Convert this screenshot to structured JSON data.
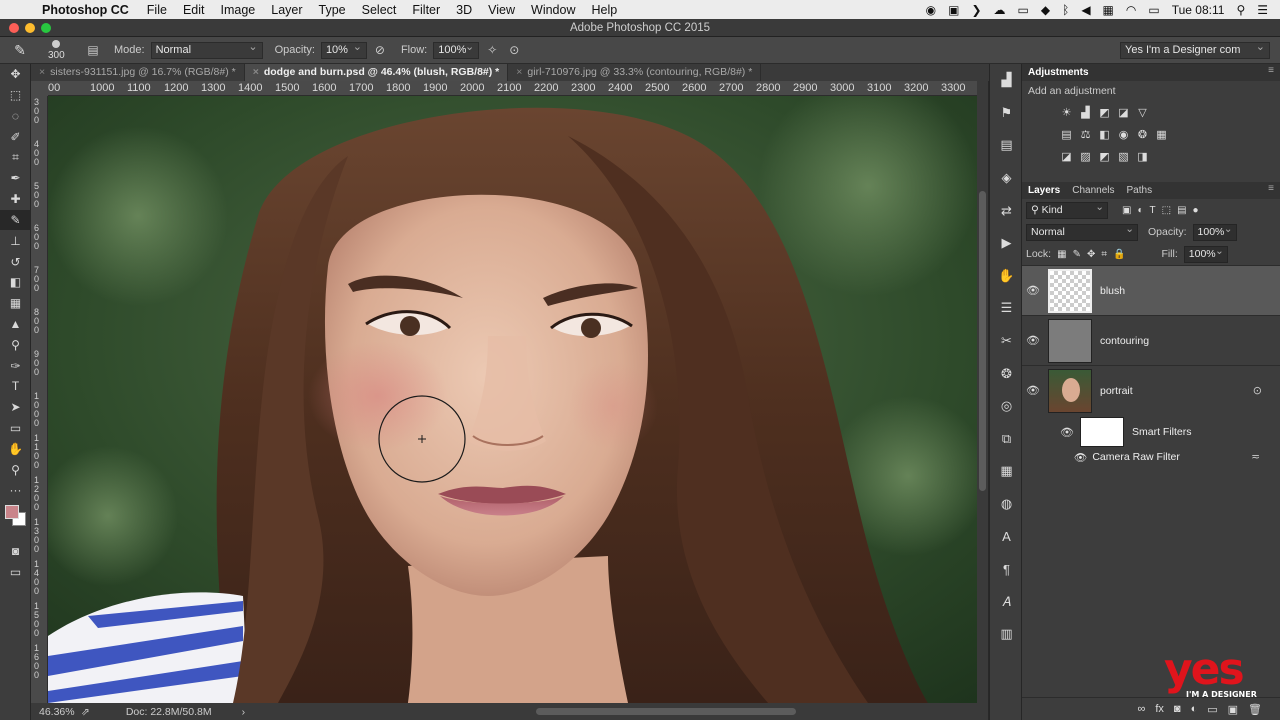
{
  "menubar": {
    "app": "Photoshop CC",
    "items": [
      "File",
      "Edit",
      "Image",
      "Layer",
      "Type",
      "Select",
      "Filter",
      "3D",
      "View",
      "Window",
      "Help"
    ],
    "clock": "Tue 08:11"
  },
  "window": {
    "title": "Adobe Photoshop CC 2015"
  },
  "options": {
    "brush_size": "300",
    "mode_label": "Mode:",
    "mode_value": "Normal",
    "opacity_label": "Opacity:",
    "opacity_value": "10%",
    "flow_label": "Flow:",
    "flow_value": "100%",
    "workspace": "Yes I'm a Designer com"
  },
  "tabs": [
    {
      "label": "sisters-931151.jpg @ 16.7% (RGB/8#) *",
      "active": false
    },
    {
      "label": "dodge and burn.psd @ 46.4% (blush, RGB/8#) *",
      "active": true
    },
    {
      "label": "girl-710976.jpg @ 33.3% (contouring, RGB/8#) *",
      "active": false
    }
  ],
  "ruler_top": [
    "00",
    "1000",
    "1100",
    "1200",
    "1300",
    "1400",
    "1500",
    "1600",
    "1700",
    "1800",
    "1900",
    "2000",
    "2100",
    "2200",
    "2300",
    "2400",
    "2500",
    "2600",
    "2700",
    "2800",
    "2900",
    "3000",
    "3100",
    "3200",
    "3300"
  ],
  "ruler_left": [
    "300",
    "400",
    "500",
    "600",
    "700",
    "800",
    "900",
    "1000",
    "1100",
    "1200",
    "1300",
    "1400",
    "1500",
    "1600"
  ],
  "status": {
    "zoom": "46.36%",
    "doc": "Doc: 22.8M/50.8M"
  },
  "panels": {
    "adjustments_tab": "Adjustments",
    "add_adjustment": "Add an adjustment",
    "layers_tabs": [
      "Layers",
      "Channels",
      "Paths"
    ],
    "kind_filter": "Kind",
    "blend_mode": "Normal",
    "opacity_label": "Opacity:",
    "opacity_value": "100%",
    "lock_label": "Lock:",
    "fill_label": "Fill:",
    "fill_value": "100%",
    "layers": [
      {
        "name": "blush",
        "selected": true
      },
      {
        "name": "contouring",
        "selected": false
      },
      {
        "name": "portrait",
        "selected": false
      }
    ],
    "smart_filters": "Smart Filters",
    "filter_name": "Camera Raw Filter"
  },
  "watermark": {
    "brand": "yes",
    "tagline": "I'M A DESIGNER"
  },
  "colors": {
    "foreground": "#c9848a",
    "background": "#ffffff",
    "accent": "#e0141c"
  }
}
